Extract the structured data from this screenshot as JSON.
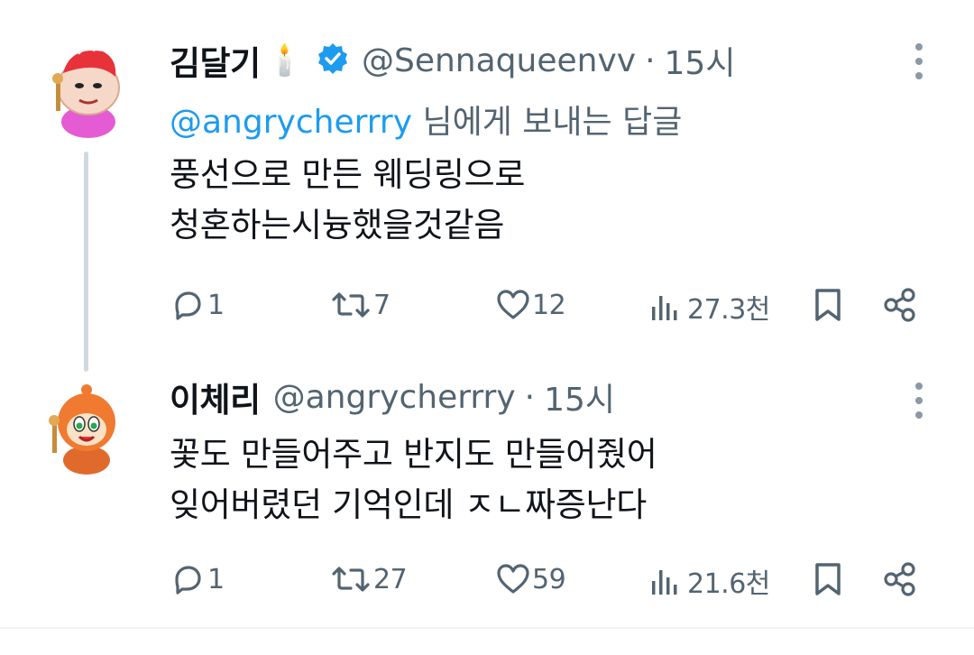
{
  "thread": {
    "tweets": [
      {
        "display_name": "김달기",
        "emoji": "🕯️",
        "verified": true,
        "handle": "@Sennaqueenvv",
        "dot": "·",
        "time": "15시",
        "reply_mention": "@angrycherrry",
        "reply_suffix": " 님에게 보내는 답글",
        "lines": [
          "풍선으로 만든 웨딩링으로",
          "청혼하는시늉했을것같음"
        ],
        "stats": {
          "replies": "1",
          "retweets": "7",
          "likes": "12",
          "views": "27.3천"
        },
        "avatar_icon": "cartoon-pink-character-avatar"
      },
      {
        "display_name": "이체리",
        "handle": "@angrycherrry",
        "dot": "·",
        "time": "15시",
        "lines": [
          "꽃도 만들어주고 반지도 만들어줬어",
          "잊어버렸던 기억인데 ㅈㄴ짜증난다"
        ],
        "stats": {
          "replies": "1",
          "retweets": "27",
          "likes": "59",
          "views": "21.6천"
        },
        "avatar_icon": "cartoon-orange-character-avatar"
      }
    ]
  },
  "colors": {
    "accent": "#1d9bf0",
    "muted": "#536471",
    "text": "#0f1419",
    "thread_line": "#cfd9de"
  }
}
